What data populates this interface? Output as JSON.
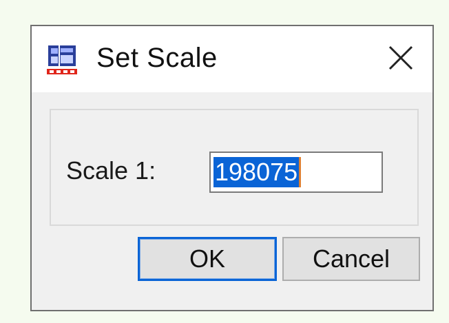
{
  "dialog": {
    "title": "Set Scale",
    "app_icon": "app-logo-icon",
    "close_icon": "close-icon"
  },
  "form": {
    "scale_label": "Scale 1:",
    "scale_value": "198075"
  },
  "buttons": {
    "ok_label": "OK",
    "cancel_label": "Cancel"
  },
  "colors": {
    "selection": "#0a64d6",
    "background": "#f5fbef",
    "dialog": "#f0f0f0"
  }
}
